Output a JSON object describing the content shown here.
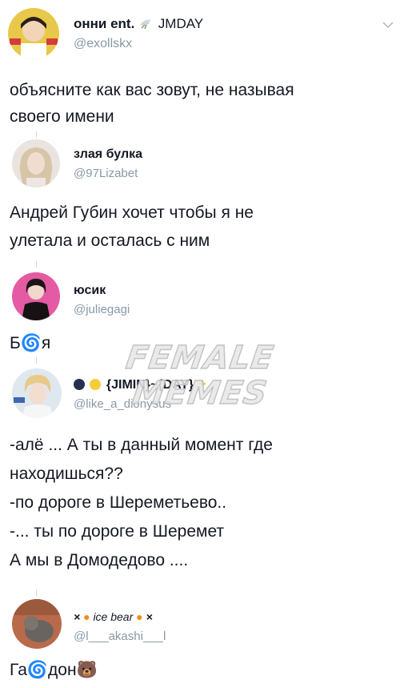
{
  "main_tweet": {
    "display_name": "онни ent.",
    "name_suffix": "JMDAY",
    "handle": "@exollskx",
    "text": "объясните как вас зовут, не называя\nсвоего имени"
  },
  "replies": [
    {
      "display_name": "злая булка",
      "handle": "@97Lizabet",
      "text": "Андрей Губин хочет чтобы я не\nулетала и осталась с ним"
    },
    {
      "display_name": "юсик",
      "handle": "@juliegagi",
      "text": "Б🌀я"
    },
    {
      "display_name": "{JIMIN}~{DAY}",
      "handle": "@like_a_dionysus",
      "text": "-алё ... А ты в данный момент где\nнаходишься??\n-по дороге в Шереметьево..\n-... ты по дороге в Шеремет\nА мы в Домодедово ...."
    },
    {
      "display_name": "ice bear",
      "handle": "@l___akashi___l",
      "text": "Га🌀дон🐻"
    }
  ],
  "watermark": [
    "FEMALE",
    "MEMES"
  ],
  "colors": {
    "text": "#141823",
    "handle": "#8899a6",
    "thread_line": "#cfd9de"
  },
  "icons": [
    "chevron-down-icon",
    "dove-emoji-icon",
    "sparkle-emoji-icon",
    "pumpkin-emoji-icon"
  ]
}
